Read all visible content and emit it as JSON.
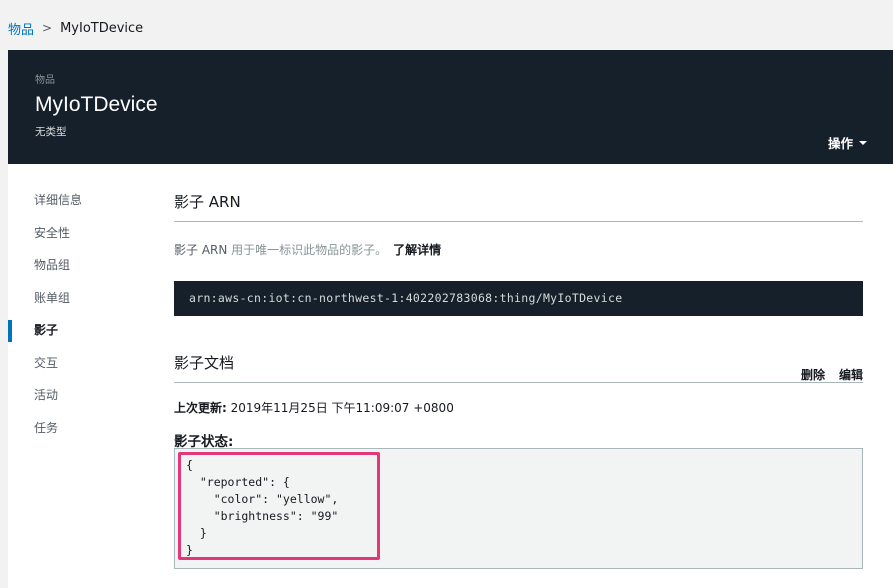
{
  "breadcrumb": {
    "parent": "物品",
    "separator": ">",
    "current": "MyIoTDevice"
  },
  "header": {
    "eyebrow": "物品",
    "title": "MyIoTDevice",
    "subtitle": "无类型",
    "actions_label": "操作"
  },
  "nav": {
    "items": [
      {
        "label": "详细信息"
      },
      {
        "label": "安全性"
      },
      {
        "label": "物品组"
      },
      {
        "label": "账单组"
      },
      {
        "label": "影子",
        "active": true
      },
      {
        "label": "交互"
      },
      {
        "label": "活动"
      },
      {
        "label": "任务"
      }
    ]
  },
  "shadow_arn": {
    "title": "影子 ARN",
    "description_arn": "影子 ARN",
    "description_rest": " 用于唯一标识此物品的影子。",
    "learn_more": "了解详情",
    "arn": "arn:aws-cn:iot:cn-northwest-1:402202783068:thing/MyIoTDevice"
  },
  "shadow_doc": {
    "title": "影子文档",
    "delete_label": "删除",
    "edit_label": "编辑",
    "last_updated_label": "上次更新:",
    "last_updated_value": " 2019年11月25日 下午11:09:07 +0800",
    "state_label": "影子状态:",
    "state_json": "{\n  \"reported\": {\n    \"color\": \"yellow\",\n    \"brightness\": \"99\"\n  }\n}"
  },
  "colors": {
    "header_bg": "#16202b",
    "link": "#0073bb",
    "highlight": "#e4367b"
  }
}
